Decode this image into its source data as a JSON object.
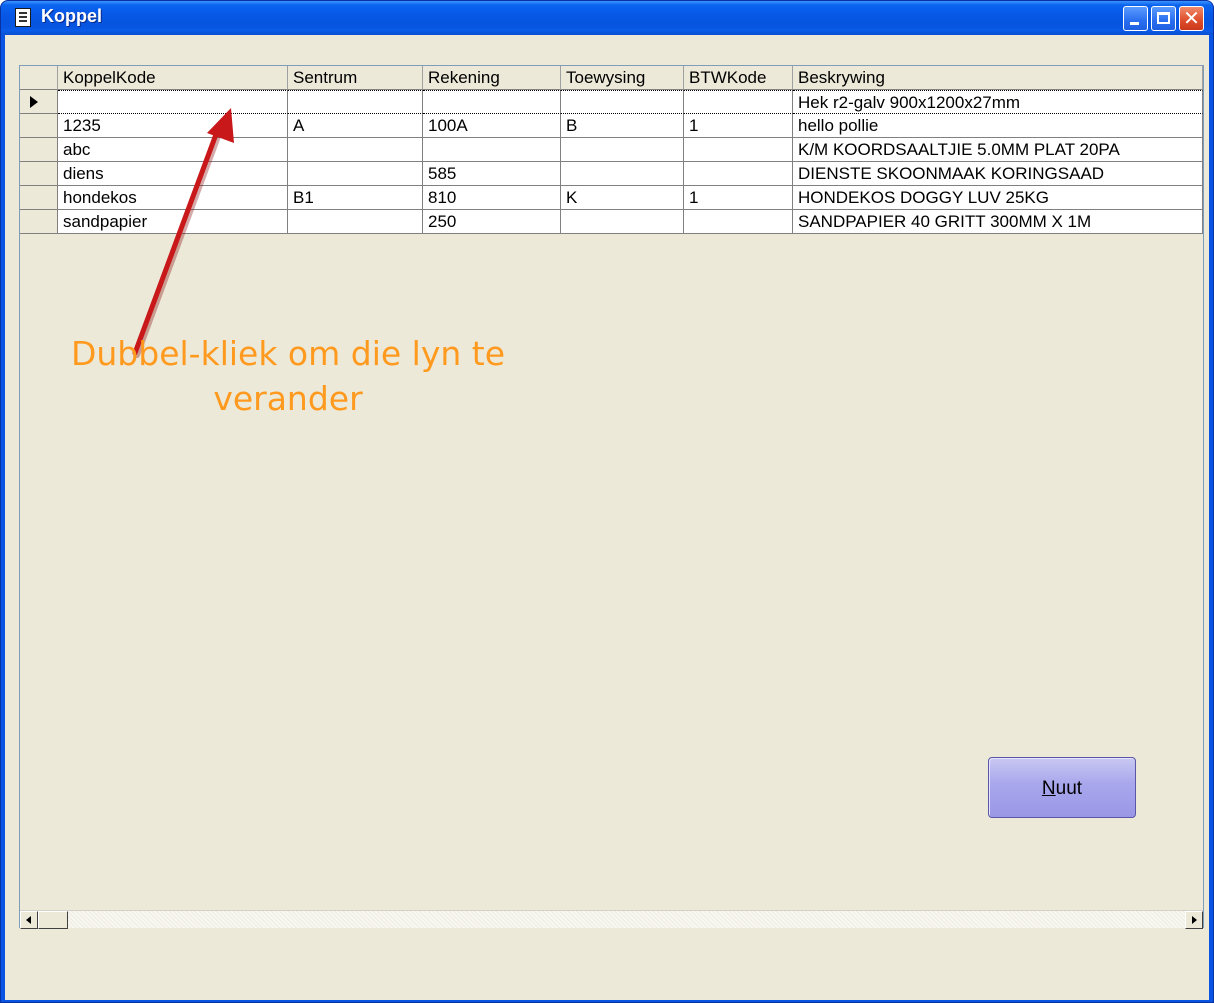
{
  "window": {
    "title": "Koppel"
  },
  "grid": {
    "columns": [
      "KoppelKode",
      "Sentrum",
      "Rekening",
      "Toewysing",
      "BTWKode",
      "Beskrywing"
    ],
    "rows": [
      {
        "KoppelKode": "",
        "Sentrum": "",
        "Rekening": "",
        "Toewysing": "",
        "BTWKode": "",
        "Beskrywing": "Hek r2-galv  900x1200x27mm",
        "selected": true
      },
      {
        "KoppelKode": "1235",
        "Sentrum": "A",
        "Rekening": "100A",
        "Toewysing": "B",
        "BTWKode": "1",
        "Beskrywing": "hello pollie"
      },
      {
        "KoppelKode": "abc",
        "Sentrum": "",
        "Rekening": "",
        "Toewysing": "",
        "BTWKode": "",
        "Beskrywing": "K/M KOORDSAALTJIE  5.0MM PLAT 20PA"
      },
      {
        "KoppelKode": "diens",
        "Sentrum": "",
        "Rekening": "585",
        "Toewysing": "",
        "BTWKode": "",
        "Beskrywing": "DIENSTE SKOONMAAK KORINGSAAD"
      },
      {
        "KoppelKode": "hondekos",
        "Sentrum": "B1",
        "Rekening": "810",
        "Toewysing": "K",
        "BTWKode": "1",
        "Beskrywing": "HONDEKOS DOGGY LUV 25KG"
      },
      {
        "KoppelKode": "sandpapier",
        "Sentrum": "",
        "Rekening": "250",
        "Toewysing": "",
        "BTWKode": "",
        "Beskrywing": "SANDPAPIER  40 GRITT 300MM X 1M"
      }
    ]
  },
  "annotation": {
    "line1": "Dubbel-kliek om die lyn te",
    "line2": "verander",
    "color": "#ff9a1f",
    "arrow_color": "#c8181a"
  },
  "buttons": {
    "nuut_accel": "N",
    "nuut_rest": "uut"
  },
  "icons": {
    "window_icon": "notepad-icon",
    "minimize": "minimize-icon",
    "maximize": "maximize-icon",
    "close": "close-icon",
    "row_selector": "row-pointer-icon",
    "scroll_left": "scroll-left-icon",
    "scroll_right": "scroll-right-icon"
  }
}
